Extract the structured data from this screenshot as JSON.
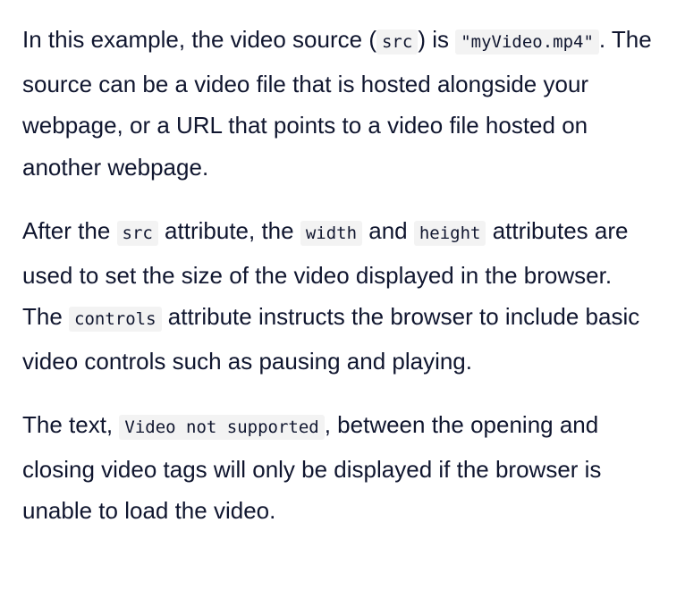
{
  "paragraphs": [
    {
      "segments": [
        {
          "type": "text",
          "value": "In this example, the video source ("
        },
        {
          "type": "code",
          "value": "src"
        },
        {
          "type": "text",
          "value": ") is "
        },
        {
          "type": "code",
          "value": "\"myVideo.mp4\""
        },
        {
          "type": "text",
          "value": ". The source can be a video file that is hosted alongside your webpage, or a URL that points to a video file hosted on another webpage."
        }
      ]
    },
    {
      "segments": [
        {
          "type": "text",
          "value": "After the "
        },
        {
          "type": "code",
          "value": "src"
        },
        {
          "type": "text",
          "value": " attribute, the "
        },
        {
          "type": "code",
          "value": "width"
        },
        {
          "type": "text",
          "value": " and "
        },
        {
          "type": "code",
          "value": "height"
        },
        {
          "type": "text",
          "value": " attributes are used to set the size of the video displayed in the browser. The "
        },
        {
          "type": "code",
          "value": "controls"
        },
        {
          "type": "text",
          "value": " attribute instructs the browser to include basic video controls such as pausing and playing."
        }
      ]
    },
    {
      "segments": [
        {
          "type": "text",
          "value": "The text, "
        },
        {
          "type": "code",
          "value": "Video not supported"
        },
        {
          "type": "text",
          "value": ", between the opening and closing video tags will only be displayed if the browser is unable to load the video."
        }
      ]
    }
  ]
}
